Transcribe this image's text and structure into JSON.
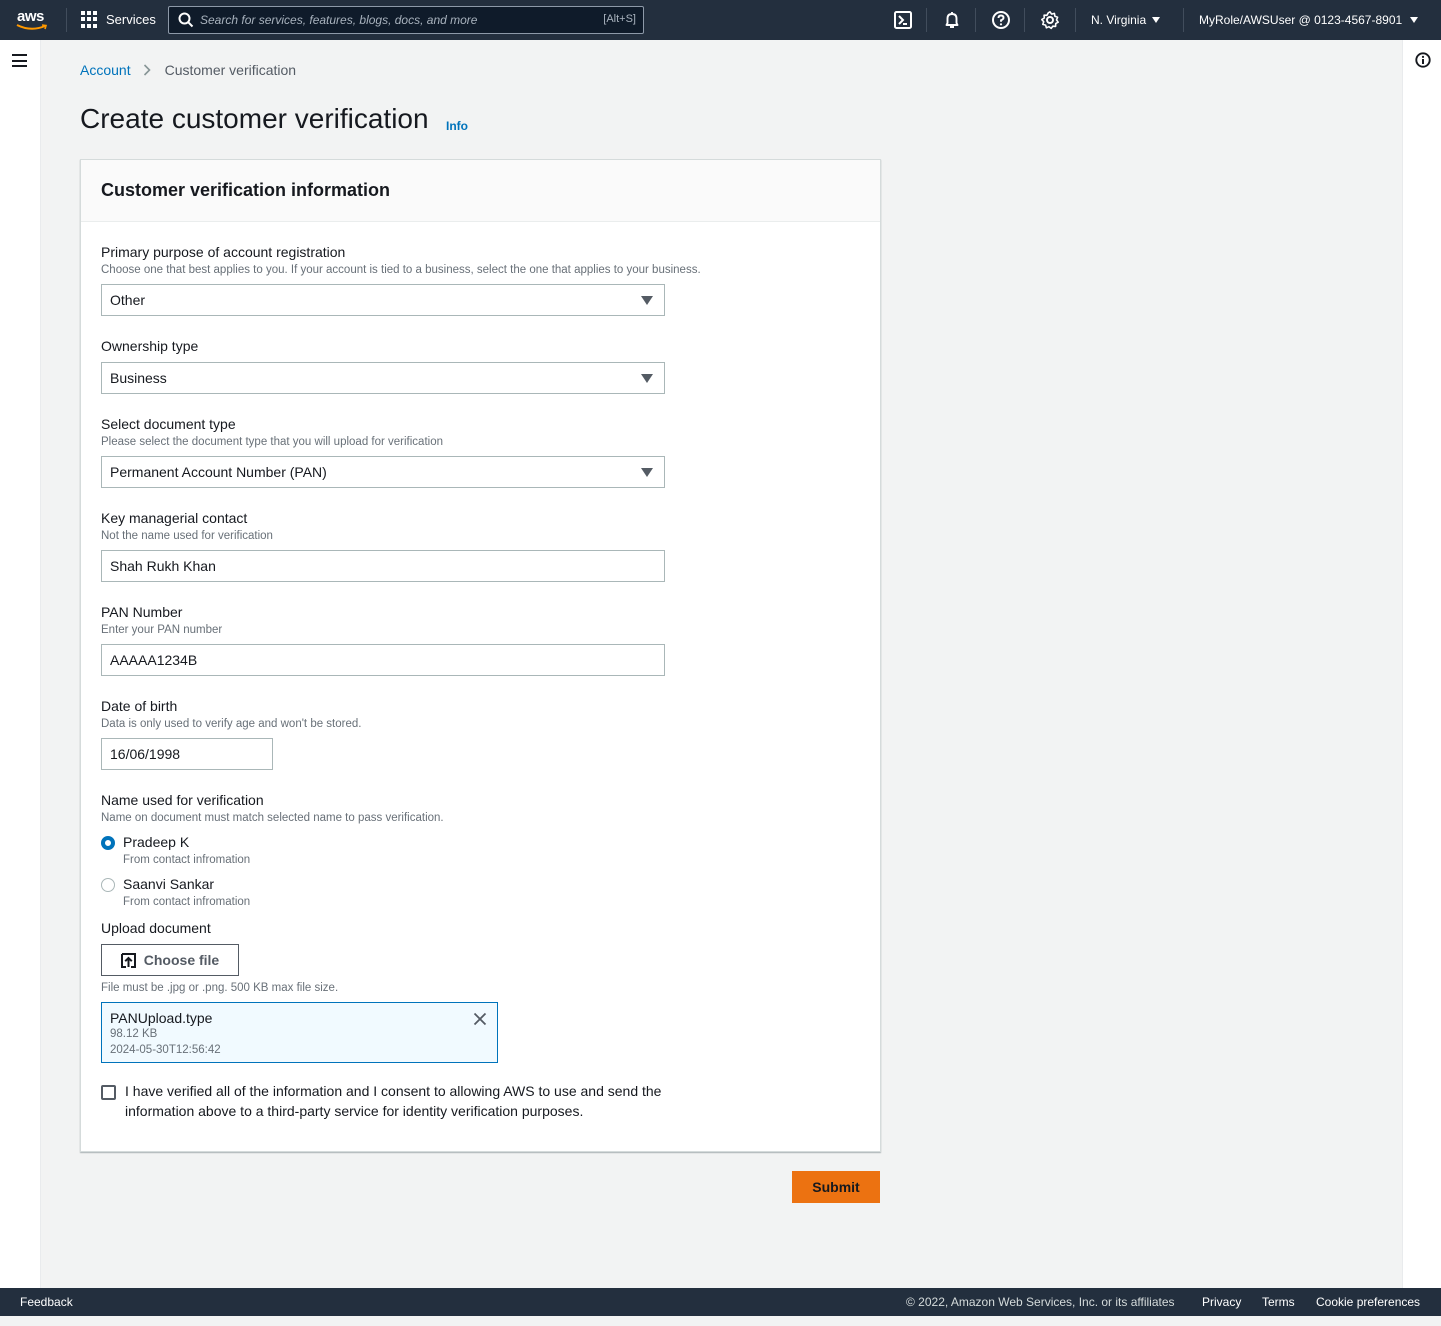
{
  "topnav": {
    "logo_text": "aws",
    "services_label": "Services",
    "search_placeholder": "Search for services, features, blogs, docs, and more",
    "search_shortcut": "[Alt+S]",
    "region": "N. Virginia",
    "account": "MyRole/AWSUser @ 0123-4567-8901",
    "icons": [
      "cloudshell-icon",
      "notifications-icon",
      "help-icon",
      "settings-icon"
    ]
  },
  "breadcrumb": {
    "root": "Account",
    "current": "Customer verification"
  },
  "page": {
    "title": "Create customer verification",
    "info_link": "Info"
  },
  "panel": {
    "title": "Customer verification information",
    "purpose": {
      "label": "Primary purpose of account registration",
      "description": "Choose one that best applies to you. If your account is tied to a business, select the one that applies to your business.",
      "value": "Other"
    },
    "ownership": {
      "label": "Ownership type",
      "value": "Business"
    },
    "doc_type": {
      "label": "Select document type",
      "description": "Please select the document type that you will upload for verification",
      "value": "Permanent Account Number (PAN)"
    },
    "contact": {
      "label": "Key managerial contact",
      "description": "Not the name used for verification",
      "value": "Shah Rukh Khan"
    },
    "pan": {
      "label": "PAN Number",
      "description": "Enter your PAN number",
      "value": "AAAAA1234B"
    },
    "dob": {
      "label": "Date of birth",
      "description": "Data is only used to verify age and won't be stored.",
      "value": "16/06/1998"
    },
    "name_verification": {
      "label": "Name used for verification",
      "description": "Name on document must match selected name to pass verification.",
      "options": [
        {
          "label": "Pradeep K",
          "description": "From contact infromation",
          "selected": true
        },
        {
          "label": "Saanvi Sankar",
          "description": "From contact infromation",
          "selected": false
        }
      ]
    },
    "upload": {
      "label": "Upload document",
      "button": "Choose file",
      "constraint": "File must be .jpg or .png. 500 KB max file size.",
      "file": {
        "name": "PANUpload.type",
        "size": "98.12 KB",
        "modified": "2024-05-30T12:56:42"
      }
    },
    "consent": {
      "text": "I have verified all of the information and I consent to allowing AWS to use and send the information above to a third-party service for identity verification purposes.",
      "checked": false
    }
  },
  "actions": {
    "submit": "Submit"
  },
  "footer": {
    "feedback": "Feedback",
    "copyright": "© 2022, Amazon Web Services, Inc. or its affiliates",
    "privacy": "Privacy",
    "terms": "Terms",
    "cookies": "Cookie preferences"
  },
  "colors": {
    "nav_bg": "#232f3e",
    "link": "#0073bb",
    "primary_button": "#ec7211",
    "page_bg": "#f2f3f3"
  }
}
